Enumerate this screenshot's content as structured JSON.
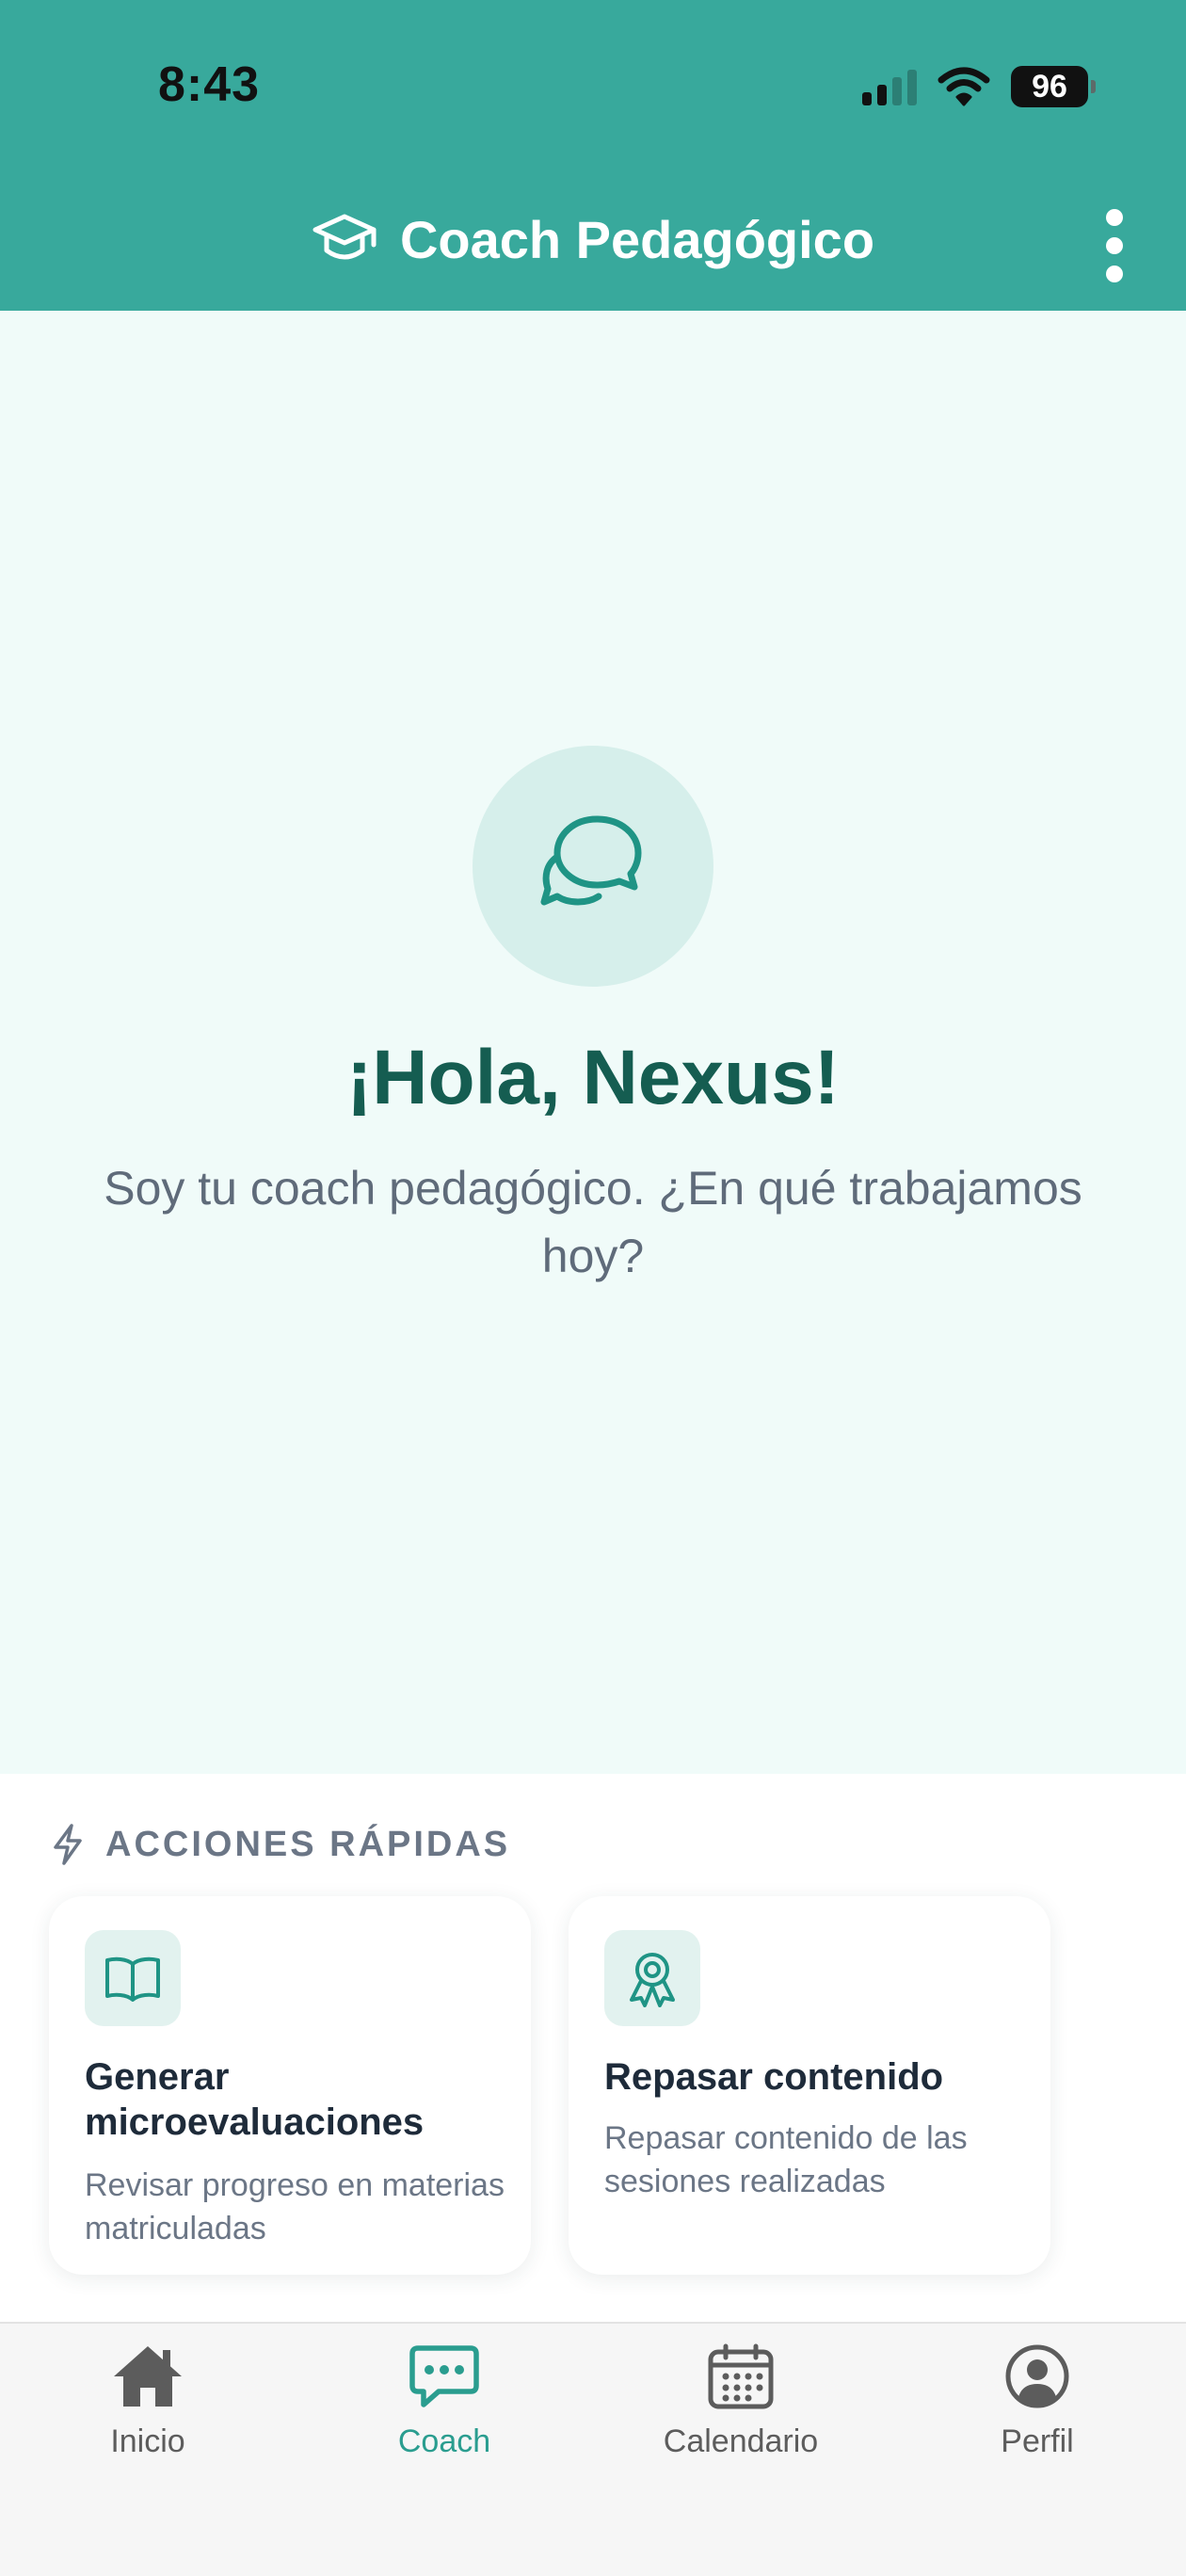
{
  "status_bar": {
    "time": "8:43",
    "battery": "96"
  },
  "header": {
    "title": "Coach Pedagógico",
    "icon": "graduation-cap-icon",
    "menu_icon": "more-vertical-icon"
  },
  "empty_state": {
    "icon": "chat-bubbles-icon",
    "greeting": "¡Hola, Nexus!",
    "subtitle": "Soy tu coach pedagógico. ¿En qué trabajamos hoy?"
  },
  "quick_actions": {
    "heading": "ACCIONES RÁPIDAS",
    "heading_icon": "lightning-icon",
    "cards": [
      {
        "icon": "book-open-icon",
        "title": "Generar microevaluaciones",
        "description": "Revisar progreso en materias matriculadas"
      },
      {
        "icon": "award-ribbon-icon",
        "title": "Repasar contenido",
        "description": "Repasar contenido de las sesiones realizadas"
      }
    ]
  },
  "bottom_nav": {
    "items": [
      {
        "label": "Inicio",
        "icon": "home-icon",
        "active": false
      },
      {
        "label": "Coach",
        "icon": "chat-icon",
        "active": true
      },
      {
        "label": "Calendario",
        "icon": "calendar-icon",
        "active": false
      },
      {
        "label": "Perfil",
        "icon": "user-circle-icon",
        "active": false
      }
    ]
  },
  "colors": {
    "header": "#38a99c",
    "background": "#f0fbf9",
    "accent": "#2a9d8f",
    "greeting": "#155d51"
  }
}
